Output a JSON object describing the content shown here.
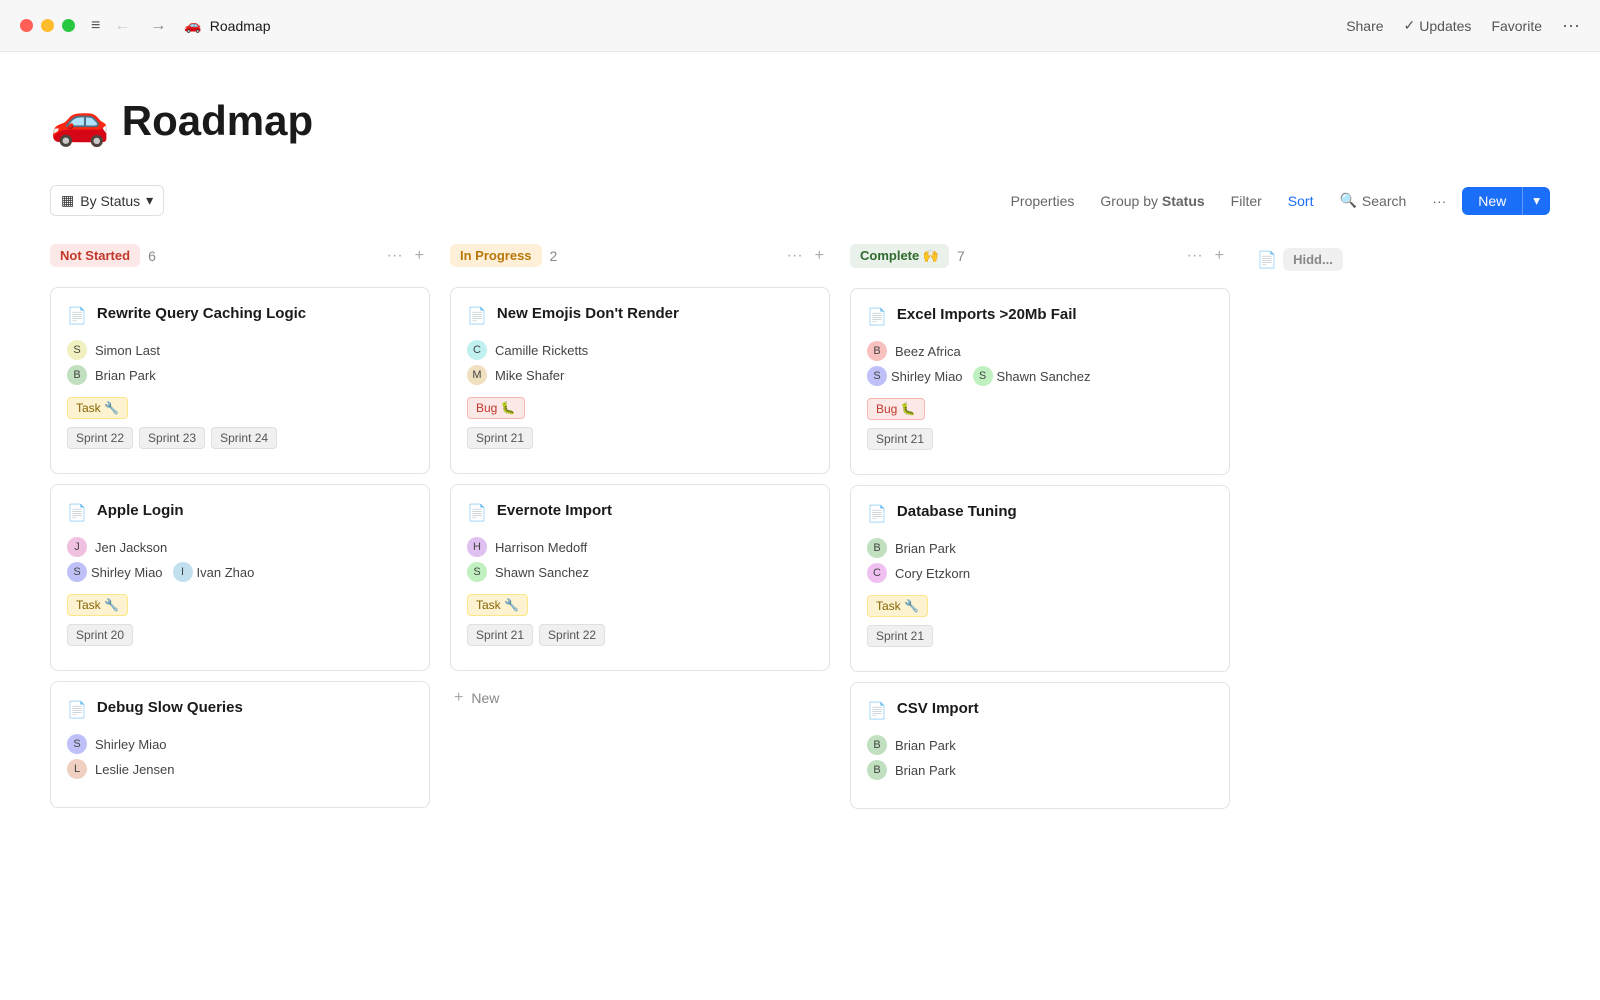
{
  "titleBar": {
    "pageTitle": "Roadmap",
    "pageEmoji": "🚗",
    "shareLabel": "Share",
    "updatesLabel": "Updates",
    "favoriteLabel": "Favorite",
    "moreLabel": "···"
  },
  "pageHeading": {
    "emoji": "🚗",
    "title": "Roadmap"
  },
  "toolbar": {
    "viewSelectorLabel": "By Status",
    "propertiesLabel": "Properties",
    "groupByLabel": "Group by",
    "groupByValue": "Status",
    "filterLabel": "Filter",
    "sortLabel": "Sort",
    "searchLabel": "Search",
    "moreLabel": "···",
    "newLabel": "New"
  },
  "columns": [
    {
      "id": "not-started",
      "statusLabel": "Not Started",
      "badgeClass": "badge-not-started",
      "count": "6",
      "cards": [
        {
          "title": "Rewrite Query Caching Logic",
          "people": [
            {
              "name": "Simon Last",
              "avatarClass": "avatar-simon"
            },
            {
              "name": "Brian Park",
              "avatarClass": "avatar-brian"
            }
          ],
          "tags": [
            {
              "label": "Task 🔧",
              "class": "tag-task"
            }
          ],
          "sprints": [
            "Sprint 22",
            "Sprint 23",
            "Sprint 24"
          ]
        },
        {
          "title": "Apple Login",
          "people": [
            {
              "name": "Jen Jackson",
              "avatarClass": "avatar-jen"
            },
            {
              "name": "Shirley Miao",
              "avatarClass": "avatar-shirley"
            },
            {
              "name": "Ivan Zhao",
              "avatarClass": "avatar-ivan",
              "inline": true
            }
          ],
          "tags": [
            {
              "label": "Task 🔧",
              "class": "tag-task"
            }
          ],
          "sprints": [
            "Sprint 20"
          ]
        },
        {
          "title": "Debug Slow Queries",
          "people": [
            {
              "name": "Shirley Miao",
              "avatarClass": "avatar-shirley"
            },
            {
              "name": "Leslie Jensen",
              "avatarClass": "avatar-leslie"
            }
          ],
          "tags": [],
          "sprints": []
        }
      ]
    },
    {
      "id": "in-progress",
      "statusLabel": "In Progress",
      "badgeClass": "badge-in-progress",
      "count": "2",
      "cards": [
        {
          "title": "New Emojis Don't Render",
          "people": [
            {
              "name": "Camille Ricketts",
              "avatarClass": "avatar-camille"
            },
            {
              "name": "Mike Shafer",
              "avatarClass": "avatar-mike"
            }
          ],
          "tags": [
            {
              "label": "Bug 🐛",
              "class": "tag-bug"
            }
          ],
          "sprints": [
            "Sprint 21"
          ]
        },
        {
          "title": "Evernote Import",
          "people": [
            {
              "name": "Harrison Medoff",
              "avatarClass": "avatar-harrison"
            },
            {
              "name": "Shawn Sanchez",
              "avatarClass": "avatar-shawn"
            }
          ],
          "tags": [
            {
              "label": "Task 🔧",
              "class": "tag-task"
            }
          ],
          "sprints": [
            "Sprint 21",
            "Sprint 22"
          ]
        }
      ],
      "addNew": true
    },
    {
      "id": "complete",
      "statusLabel": "Complete 🙌",
      "badgeClass": "badge-complete",
      "count": "7",
      "cards": [
        {
          "title": "Excel Imports >20Mb Fail",
          "people": [
            {
              "name": "Beez Africa",
              "avatarClass": "avatar-beez"
            },
            {
              "name": "Shirley Miao",
              "avatarClass": "avatar-shirley"
            },
            {
              "name": "Shawn Sanchez",
              "avatarClass": "avatar-shawn",
              "inline": true
            }
          ],
          "tags": [
            {
              "label": "Bug 🐛",
              "class": "tag-bug"
            }
          ],
          "sprints": [
            "Sprint 21"
          ]
        },
        {
          "title": "Database Tuning",
          "people": [
            {
              "name": "Brian Park",
              "avatarClass": "avatar-brian"
            },
            {
              "name": "Cory Etzkorn",
              "avatarClass": "avatar-cory"
            }
          ],
          "tags": [
            {
              "label": "Task 🔧",
              "class": "tag-task"
            }
          ],
          "sprints": [
            "Sprint 21"
          ]
        },
        {
          "title": "CSV Import",
          "people": [
            {
              "name": "Brian Park",
              "avatarClass": "avatar-brian"
            },
            {
              "name": "Brian Park",
              "avatarClass": "avatar-brian"
            }
          ],
          "tags": [],
          "sprints": []
        }
      ]
    }
  ],
  "hiddenColumn": {
    "label": "Hidd..."
  },
  "icons": {
    "board": "▦",
    "chevron-down": "▾",
    "search": "🔍",
    "plus": "+",
    "dots": "···",
    "doc": "📄",
    "check": "✓",
    "back": "←",
    "forward": "→",
    "hamburger": "≡"
  }
}
